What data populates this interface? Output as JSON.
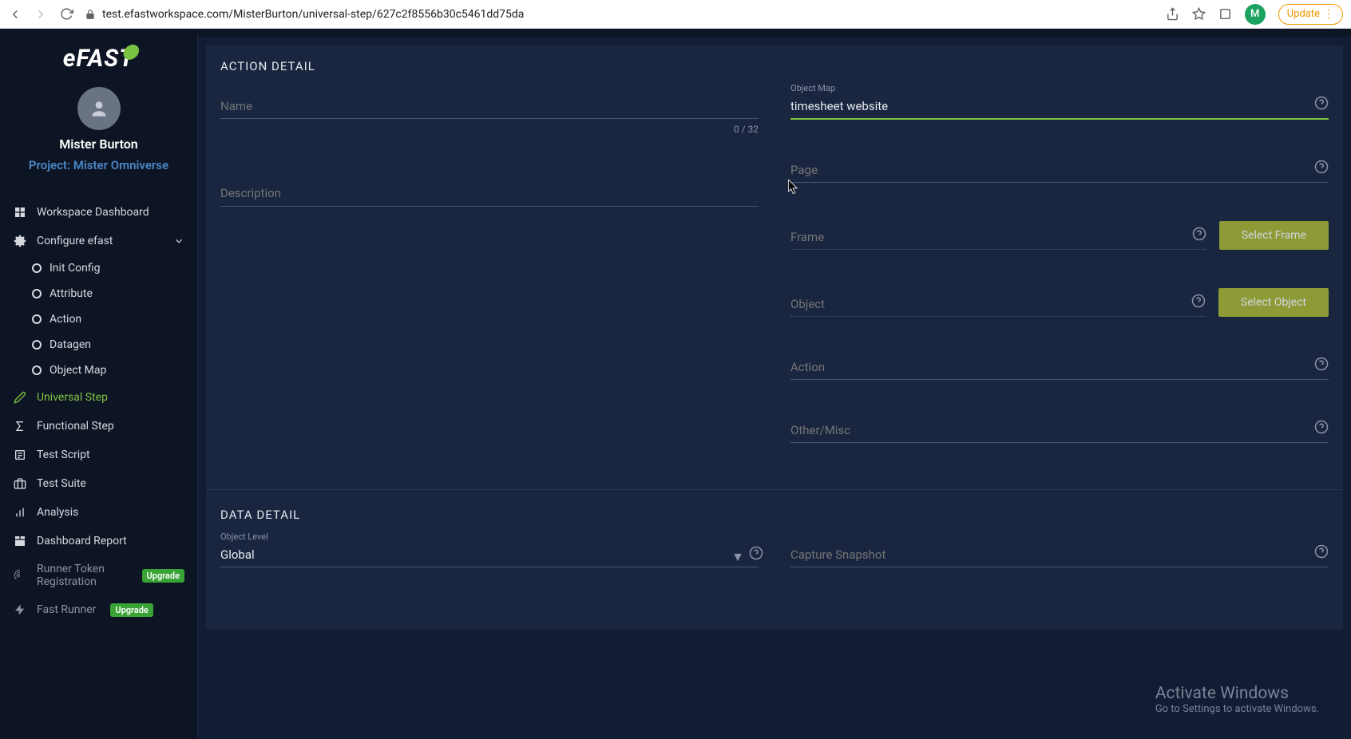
{
  "browser": {
    "url": "test.efastworkspace.com/MisterBurton/universal-step/627c2f8556b30c5461dd75da",
    "avatar_letter": "M",
    "update_label": "Update"
  },
  "logo": {
    "text_e": "e",
    "text_fast": "FAST"
  },
  "user": {
    "name": "Mister Burton",
    "project": "Project: Mister Omniverse"
  },
  "sidebar": {
    "items": [
      {
        "label": "Workspace Dashboard"
      },
      {
        "label": "Configure efast"
      },
      {
        "label": "Init Config"
      },
      {
        "label": "Attribute"
      },
      {
        "label": "Action"
      },
      {
        "label": "Datagen"
      },
      {
        "label": "Object Map"
      },
      {
        "label": "Universal Step"
      },
      {
        "label": "Functional Step"
      },
      {
        "label": "Test Script"
      },
      {
        "label": "Test Suite"
      },
      {
        "label": "Analysis"
      },
      {
        "label": "Dashboard Report"
      },
      {
        "label": "Runner Token Registration"
      },
      {
        "label": "Fast Runner"
      }
    ],
    "upgrade_badge": "Upgrade"
  },
  "action_detail": {
    "title": "ACTION DETAIL",
    "name_label": "Name",
    "name_value": "",
    "name_counter": "0 / 32",
    "description_label": "Description",
    "description_value": "",
    "object_map_label": "Object Map",
    "object_map_value": "timesheet website",
    "page_label": "Page",
    "page_value": "",
    "frame_label": "Frame",
    "frame_value": "",
    "select_frame_btn": "Select Frame",
    "object_label": "Object",
    "object_value": "",
    "select_object_btn": "Select Object",
    "action_label": "Action",
    "action_value": "",
    "other_label": "Other/Misc",
    "other_value": ""
  },
  "data_detail": {
    "title": "DATA DETAIL",
    "object_level_label": "Object Level",
    "object_level_value": "Global",
    "capture_label": "Capture Snapshot",
    "capture_value": ""
  },
  "watermark": {
    "t1": "Activate Windows",
    "t2": "Go to Settings to activate Windows."
  }
}
